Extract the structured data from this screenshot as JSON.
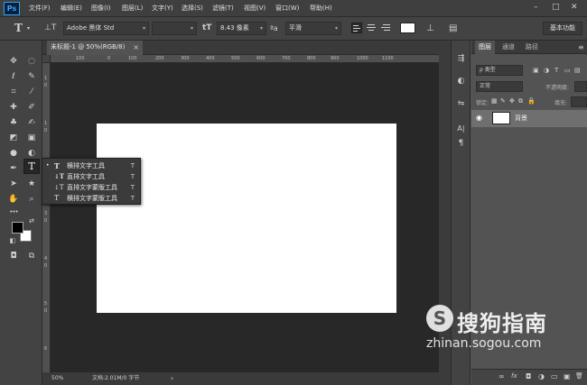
{
  "app": {
    "logo": "Ps"
  },
  "menubar": {
    "items": [
      "文件(F)",
      "编辑(E)",
      "图像(I)",
      "图层(L)",
      "文字(Y)",
      "选择(S)",
      "滤镜(T)",
      "视图(V)",
      "窗口(W)",
      "帮助(H)"
    ],
    "window_controls": [
      "–",
      "□",
      "✕"
    ]
  },
  "options_bar": {
    "tool_glyph": "T",
    "orientation_glyph": "⊥T",
    "font_family": "Adobe 黑体 Std",
    "font_style": "",
    "size_glyph": "tT",
    "font_size": "8.43 像素",
    "aa_glyph": "ªa",
    "antialias": "平滑",
    "warp_glyph": "⊥",
    "panel_glyph": "▤",
    "text_color": "#ffffff",
    "workspace": "基本功能"
  },
  "document": {
    "tab_title": "未标题-1 @ 50%(RGB/8)",
    "tab_close": "×",
    "ruler_h_ticks": [
      "100",
      "0",
      "100",
      "200",
      "300",
      "400",
      "500",
      "600",
      "700",
      "800",
      "900",
      "1000",
      "1100"
    ],
    "ruler_v_ticks": [
      "1",
      "0",
      "1",
      "0",
      "2",
      "0",
      "3",
      "0",
      "4",
      "0",
      "5",
      "0",
      "6"
    ],
    "zoom": "50%",
    "doc_info": "文档:2.01M/0 字节",
    "status_arrow": "›"
  },
  "toolbox": {
    "tools": [
      {
        "name": "move-tool-icon",
        "glyph": "✥"
      },
      {
        "name": "marquee-tool-icon",
        "glyph": "◌"
      },
      {
        "name": "lasso-tool-icon",
        "glyph": "ℓ"
      },
      {
        "name": "quick-select-tool-icon",
        "glyph": "✎"
      },
      {
        "name": "crop-tool-icon",
        "glyph": "⌗"
      },
      {
        "name": "eyedropper-tool-icon",
        "glyph": "⁄"
      },
      {
        "name": "healing-brush-tool-icon",
        "glyph": "✚"
      },
      {
        "name": "brush-tool-icon",
        "glyph": "✐"
      },
      {
        "name": "clone-stamp-tool-icon",
        "glyph": "♣"
      },
      {
        "name": "history-brush-tool-icon",
        "glyph": "✍"
      },
      {
        "name": "eraser-tool-icon",
        "glyph": "◩"
      },
      {
        "name": "gradient-tool-icon",
        "glyph": "▣"
      },
      {
        "name": "blur-tool-icon",
        "glyph": "●"
      },
      {
        "name": "dodge-tool-icon",
        "glyph": "◐"
      },
      {
        "name": "pen-tool-icon",
        "glyph": "✒"
      },
      {
        "name": "type-tool-icon",
        "glyph": "T"
      },
      {
        "name": "path-select-tool-icon",
        "glyph": "➤"
      },
      {
        "name": "shape-tool-icon",
        "glyph": "★"
      },
      {
        "name": "hand-tool-icon",
        "glyph": "✋"
      },
      {
        "name": "zoom-tool-icon",
        "glyph": "⌕"
      }
    ],
    "more_glyph": "•••",
    "swap_glyph": "⇄",
    "default_glyph": "◧",
    "quickmask_glyph": "◘",
    "screenmode_glyph": "⧉"
  },
  "flyout": {
    "items": [
      {
        "glyph": "T",
        "label": "横排文字工具",
        "key": "T",
        "selected": true
      },
      {
        "glyph": "↓T",
        "label": "直排文字工具",
        "key": "T"
      },
      {
        "glyph": "↓T",
        "label": "直排文字蒙版工具",
        "key": "T"
      },
      {
        "glyph": "T",
        "label": "横排文字蒙版工具",
        "key": "T"
      }
    ],
    "bullet": "•"
  },
  "dock": {
    "glyphs": [
      "⇶",
      "◐",
      "⇋",
      "A|",
      "¶"
    ]
  },
  "layers_panel": {
    "tabs": [
      "图层",
      "通道",
      "路径"
    ],
    "filter_label": "ρ 类型",
    "blend_mode": "正常",
    "opacity_label": "不透明度:",
    "lock_label": "锁定:",
    "fill_label": "填充:",
    "eye_glyph": "◉",
    "layer_name": "背景",
    "footer_glyphs": [
      "∞",
      "fx",
      "◘",
      "◑",
      "▭",
      "▣",
      "🗑"
    ]
  },
  "watermark": {
    "logo": "S",
    "brand": "搜狗指南",
    "url": "zhinan.sogou.com"
  }
}
